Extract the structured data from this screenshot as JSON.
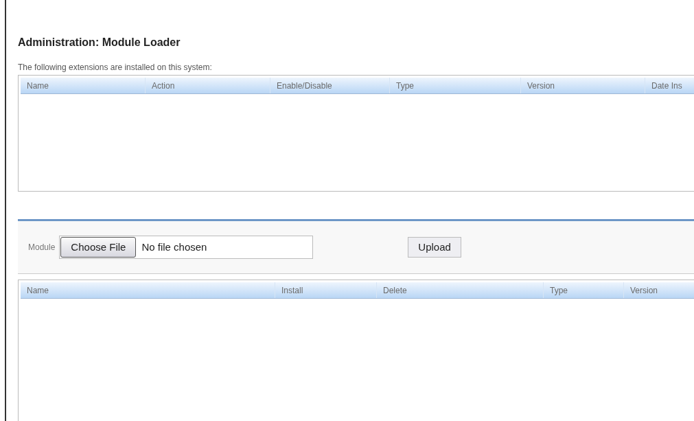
{
  "title": "Administration: Module Loader",
  "installed": {
    "caption": "The following extensions are installed on this system:",
    "columns": [
      "Name",
      "Action",
      "Enable/Disable",
      "Type",
      "Version",
      "Date Ins"
    ]
  },
  "upload": {
    "label": "Module",
    "file_button": "Choose File",
    "file_status": "No file chosen",
    "submit": "Upload"
  },
  "available": {
    "columns": [
      "Name",
      "Install",
      "Delete",
      "Type",
      "Version"
    ]
  }
}
